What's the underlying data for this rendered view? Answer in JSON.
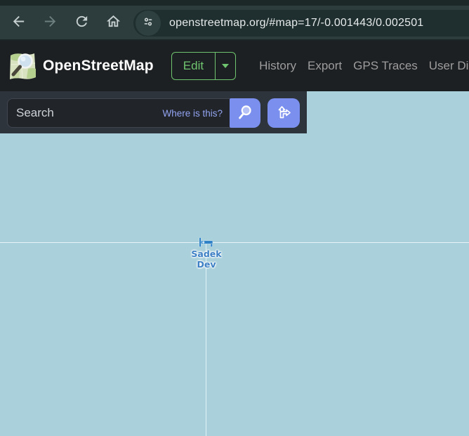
{
  "browser": {
    "url": "openstreetmap.org/#map=17/-0.001443/0.002501"
  },
  "header": {
    "title": "OpenStreetMap",
    "edit_label": "Edit",
    "nav": [
      {
        "label": "History"
      },
      {
        "label": "Export"
      },
      {
        "label": "GPS Traces"
      },
      {
        "label": "User Diaries"
      }
    ]
  },
  "search": {
    "placeholder": "Search",
    "where_is_this": "Where is this?"
  },
  "map": {
    "marker": {
      "icon": "bed-hotel-icon",
      "line1": "Sadek",
      "line2": "Dev"
    }
  },
  "colors": {
    "toolbar": "#2d3c3c",
    "toolbar_top_strip": "#1c2727",
    "address_pill": "#1f2e2e",
    "osm_header": "#1d2023",
    "edit_green": "#6fc56f",
    "nav_gray": "#9d9d9d",
    "search_panel": "#2e343c",
    "action_button_blue": "#7b90ee",
    "water": "#a9d0db",
    "marker_blue": "#2e81c6",
    "label_blue": "#3c7fc5"
  }
}
